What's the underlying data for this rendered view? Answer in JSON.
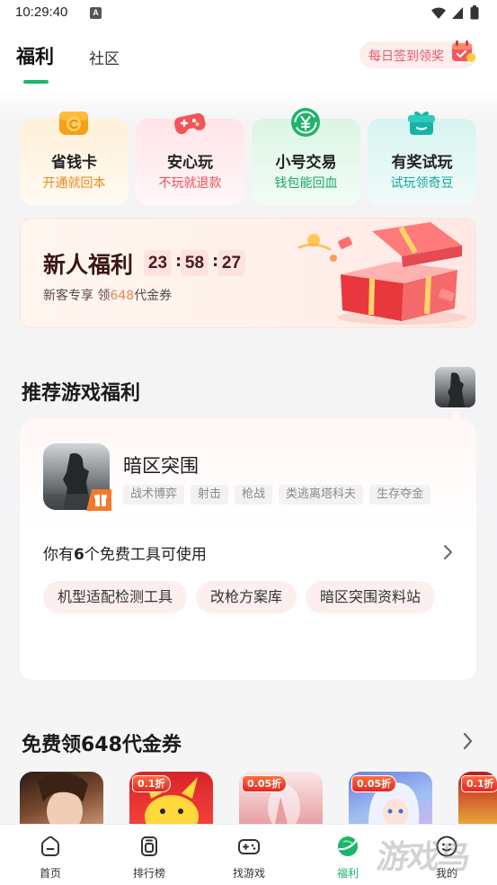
{
  "status_bar": {
    "time": "10:29:40",
    "notification_badge": "A",
    "icons": [
      "wifi-icon",
      "signal-icon",
      "battery-icon"
    ]
  },
  "header": {
    "tabs": [
      {
        "label": "福利",
        "active": true
      },
      {
        "label": "社区",
        "active": false
      }
    ],
    "daily_checkin": {
      "label": "每日签到领奖",
      "icon": "calendar-gift-icon"
    }
  },
  "feature_cards": [
    {
      "title": "省钱卡",
      "subtitle": "开通就回本",
      "icon": "savings-card-icon",
      "accent": "#f0861a"
    },
    {
      "title": "安心玩",
      "subtitle": "不玩就退款",
      "icon": "gamepad-icon",
      "accent": "#ef4f55"
    },
    {
      "title": "小号交易",
      "subtitle": "钱包能回血",
      "icon": "yuan-exchange-icon",
      "accent": "#17a860"
    },
    {
      "title": "有奖试玩",
      "subtitle": "试玩领奇豆",
      "icon": "gift-icon",
      "accent": "#13a79b"
    }
  ],
  "newbie_banner": {
    "title": "新人福利",
    "countdown": [
      "23",
      "58",
      "27"
    ],
    "separator": ":",
    "subtitle_prefix": "新客专享  领",
    "amount": "648",
    "subtitle_suffix": "代金券",
    "art": "red-gift-box-illustration"
  },
  "recommend_section": {
    "title": "推荐游戏福利",
    "thumbnail": "game-thumbnail-icon"
  },
  "game_card": {
    "name": "暗区突围",
    "tags": [
      "战术博弈",
      "射击",
      "枪战",
      "类逃离塔科夫",
      "生存夺金"
    ],
    "tools_prefix": "你有",
    "tools_count": "6",
    "tools_suffix": "个免费工具可使用",
    "tools": [
      "机型适配检测工具",
      "改枪方案库",
      "暗区突围资料站"
    ]
  },
  "voucher_section": {
    "title": "免费领648代金券",
    "games": [
      {
        "icon": "game-icon-portrait"
      },
      {
        "icon": "game-icon-pikachu",
        "badge": "0.1折"
      },
      {
        "icon": "game-icon-pink",
        "badge": "0.05折"
      },
      {
        "icon": "game-icon-anime",
        "badge": "0.05折"
      },
      {
        "icon": "game-icon-red-gold",
        "badge": "0.1折"
      }
    ]
  },
  "bottom_nav": [
    {
      "label": "首页",
      "icon": "home-icon",
      "active": false
    },
    {
      "label": "排行榜",
      "icon": "ranking-icon",
      "active": false
    },
    {
      "label": "找游戏",
      "icon": "gamepad-icon",
      "active": false
    },
    {
      "label": "福利",
      "icon": "welfare-planet-icon",
      "active": true
    },
    {
      "label": "我的",
      "icon": "smiley-profile-icon",
      "active": false
    }
  ],
  "watermark": "游戏鸟",
  "colors": {
    "accent_green": "#1db46c",
    "checkin_pink": "#e9566a",
    "voucher_badge": "#e8251f"
  }
}
